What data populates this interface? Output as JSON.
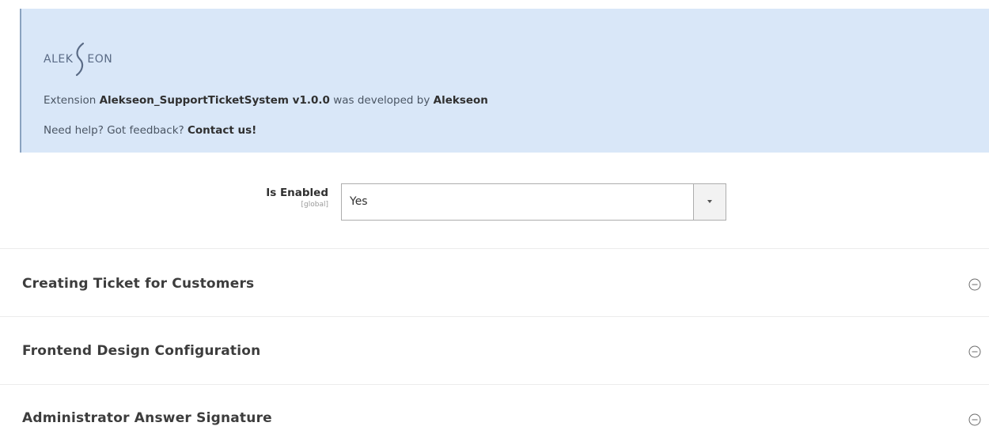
{
  "banner": {
    "logo_left": "ALEK",
    "logo_right": "EON",
    "line1_prefix": "Extension",
    "extension_name": "Alekseon_SupportTicketSystem v1.0.0",
    "line1_middle": "was developed by",
    "developer": "Alekseon",
    "line2_prefix": "Need help? Got feedback?",
    "contact_link": "Contact us!"
  },
  "is_enabled": {
    "label": "Is Enabled",
    "scope": "[global]",
    "value": "Yes"
  },
  "sections": [
    {
      "title": "Creating Ticket for Customers",
      "icon": "collapse-circle-icon"
    },
    {
      "title": "Frontend Design Configuration",
      "icon": "collapse-circle-icon"
    },
    {
      "title": "Administrator Answer Signature",
      "icon": "collapse-circle-icon"
    }
  ],
  "colors": {
    "banner_bg": "#d9e7f8",
    "banner_border": "#8aa2c0"
  }
}
